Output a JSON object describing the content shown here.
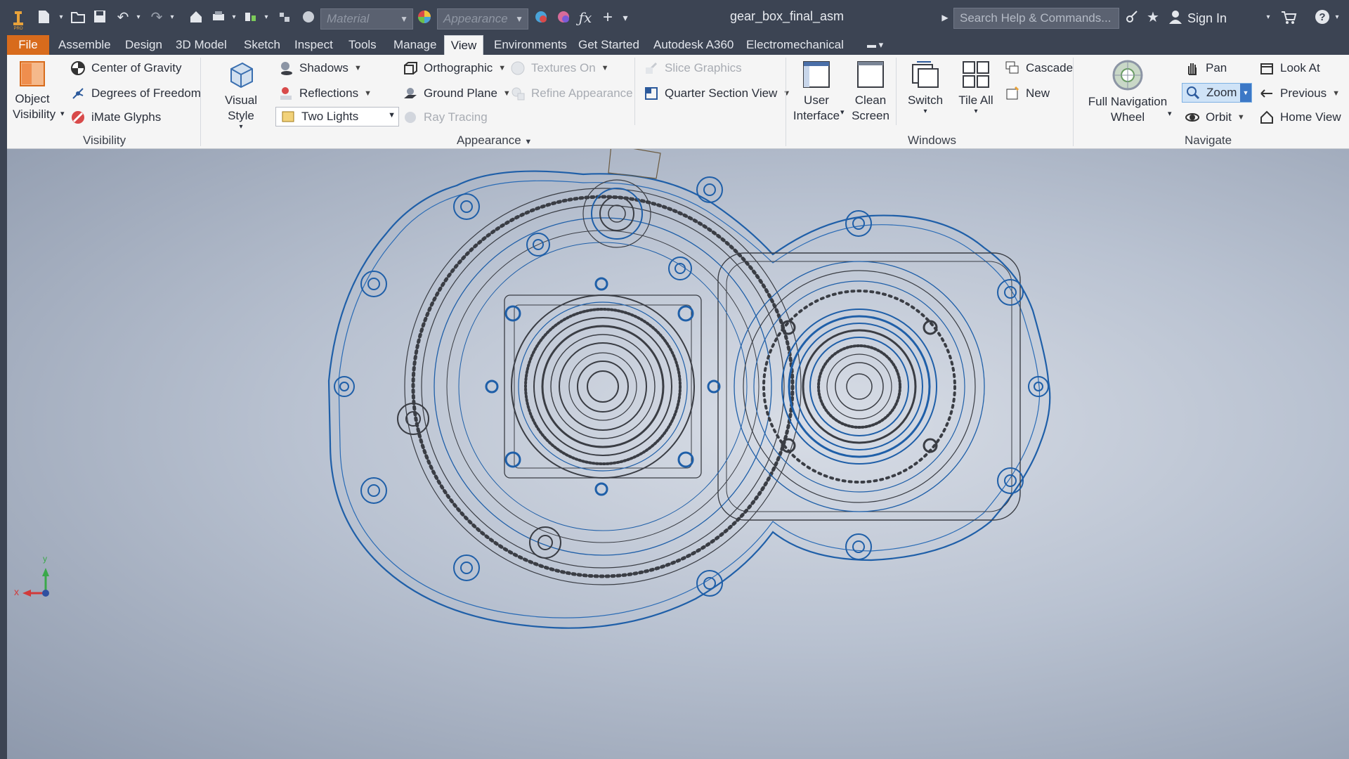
{
  "app": {
    "title": "gear_box_final_asm",
    "material_placeholder": "Material",
    "appearance_placeholder": "Appearance",
    "help_search_placeholder": "Search Help & Commands...",
    "sign_in": "Sign In"
  },
  "tabs": [
    {
      "label": "File"
    },
    {
      "label": "Assemble"
    },
    {
      "label": "Design"
    },
    {
      "label": "3D Model"
    },
    {
      "label": "Sketch"
    },
    {
      "label": "Inspect"
    },
    {
      "label": "Tools"
    },
    {
      "label": "Manage"
    },
    {
      "label": "View"
    },
    {
      "label": "Environments"
    },
    {
      "label": "Get Started"
    },
    {
      "label": "Autodesk A360"
    },
    {
      "label": "Electromechanical"
    }
  ],
  "ribbon": {
    "visibility": {
      "object_visibility_line1": "Object",
      "object_visibility_line2": "Visibility",
      "center_of_gravity": "Center of Gravity",
      "degrees_of_freedom": "Degrees of Freedom",
      "imate_glyphs": "iMate Glyphs",
      "label": "Visibility"
    },
    "appearance": {
      "visual_style": "Visual Style",
      "shadows": "Shadows",
      "reflections": "Reflections",
      "lighting": "Two Lights",
      "orthographic": "Orthographic",
      "ground_plane": "Ground Plane",
      "ray_tracing": "Ray Tracing",
      "textures_on": "Textures On",
      "refine_appearance": "Refine Appearance",
      "slice_graphics": "Slice Graphics",
      "quarter_section_view": "Quarter Section View",
      "label": "Appearance"
    },
    "windows": {
      "user_interface_line1": "User",
      "user_interface_line2": "Interface",
      "clean_screen_line1": "Clean",
      "clean_screen_line2": "Screen",
      "switch": "Switch",
      "tile_all": "Tile All",
      "cascade": "Cascade",
      "new": "New",
      "label": "Windows"
    },
    "navigate": {
      "full_nav_wheel_line1": "Full Navigation",
      "full_nav_wheel_line2": "Wheel",
      "pan": "Pan",
      "zoom": "Zoom",
      "orbit": "Orbit",
      "look_at": "Look At",
      "previous": "Previous",
      "home_view": "Home View",
      "label": "Navigate"
    }
  },
  "triad": {
    "x": "x",
    "y": "y"
  },
  "colors": {
    "accent": "#d86b1c",
    "titlebar": "#3c4453",
    "wire_blue": "#1f5fa8",
    "wire_dark": "#3a3d44"
  }
}
